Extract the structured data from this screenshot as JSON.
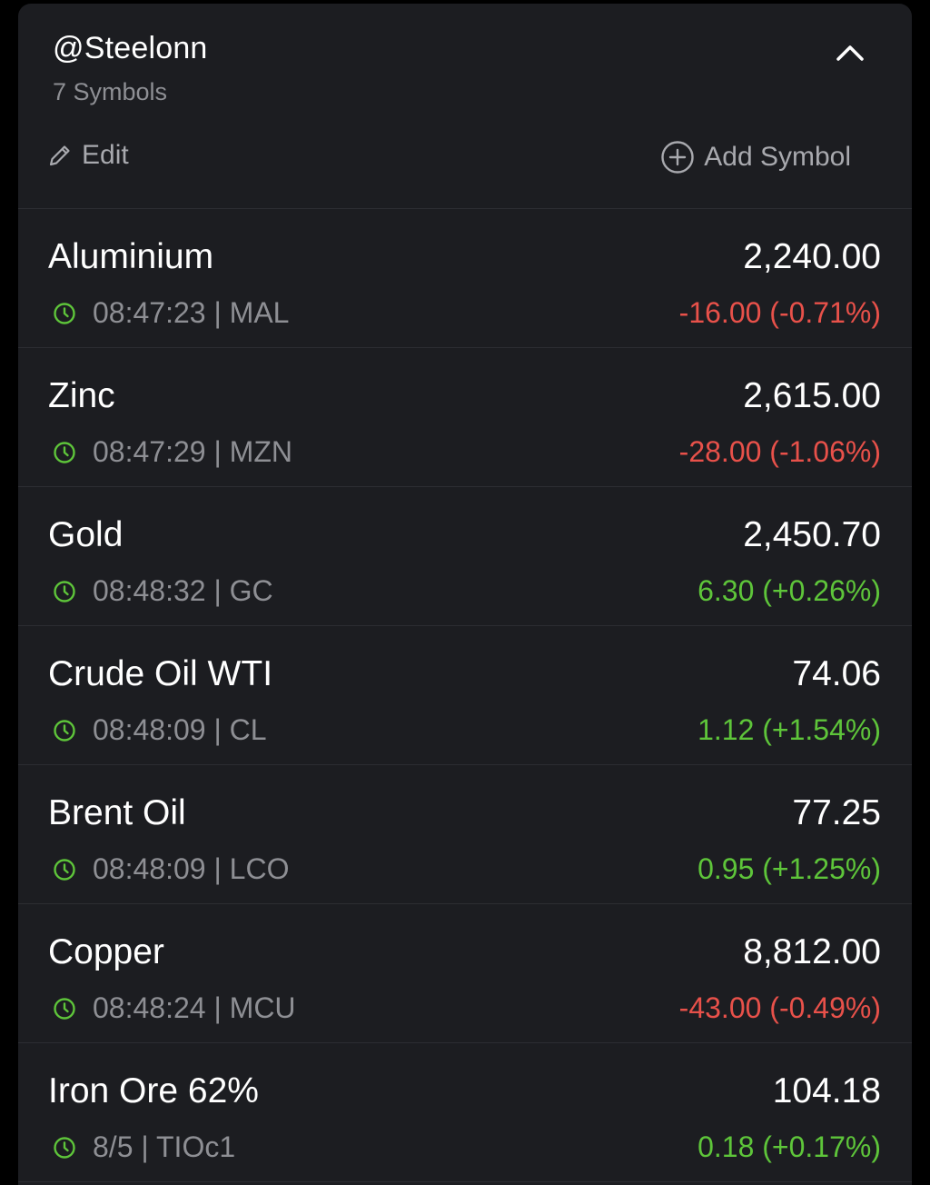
{
  "watchlist": {
    "title": "@Steelonn",
    "count_label": "7 Symbols",
    "edit_label": "Edit",
    "add_label": "Add Symbol",
    "icons": {
      "collapse": "chevron-up-icon",
      "edit": "pencil-icon",
      "add": "plus-circle-icon",
      "time": "clock-icon"
    }
  },
  "colors": {
    "negative": "#e8514a",
    "positive": "#5ec53a",
    "clock": "#5ec53a"
  },
  "symbols": [
    {
      "name": "Aluminium",
      "price": "2,240.00",
      "meta": "08:47:23 | MAL",
      "change": "-16.00 (-0.71%)",
      "direction": "neg"
    },
    {
      "name": "Zinc",
      "price": "2,615.00",
      "meta": "08:47:29 | MZN",
      "change": "-28.00 (-1.06%)",
      "direction": "neg"
    },
    {
      "name": "Gold",
      "price": "2,450.70",
      "meta": "08:48:32 | GC",
      "change": "6.30 (+0.26%)",
      "direction": "pos"
    },
    {
      "name": "Crude Oil WTI",
      "price": "74.06",
      "meta": "08:48:09 | CL",
      "change": "1.12 (+1.54%)",
      "direction": "pos"
    },
    {
      "name": "Brent Oil",
      "price": "77.25",
      "meta": "08:48:09 | LCO",
      "change": "0.95 (+1.25%)",
      "direction": "pos"
    },
    {
      "name": "Copper",
      "price": "8,812.00",
      "meta": "08:48:24 | MCU",
      "change": "-43.00 (-0.49%)",
      "direction": "neg"
    },
    {
      "name": "Iron Ore 62%",
      "price": "104.18",
      "meta": "8/5 | TIOc1",
      "change": "0.18 (+0.17%)",
      "direction": "pos"
    }
  ]
}
